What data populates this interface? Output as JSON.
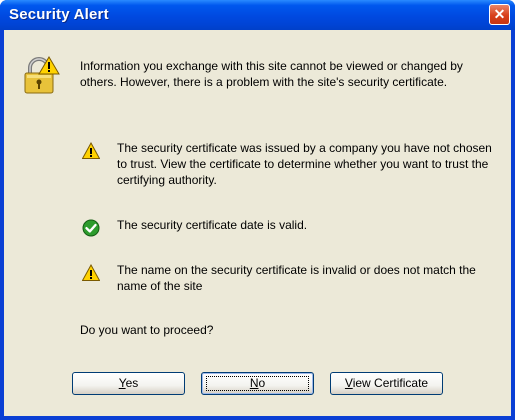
{
  "window": {
    "title": "Security Alert",
    "close_glyph": "✕"
  },
  "icons": {
    "main": "lock-warning-icon",
    "warning": "warning-icon",
    "valid": "check-icon"
  },
  "colors": {
    "titlebar": "#0054e3",
    "client": "#ece9d8",
    "close": "#d8401c",
    "warning": "#ffd200",
    "valid": "#2d9c2d"
  },
  "intro": "Information you exchange with this site cannot be viewed or changed by others. However, there is a problem with the site's security certificate.",
  "items": [
    {
      "icon": "warning-icon",
      "text": "The security certificate was issued by a company you have not chosen to trust. View the certificate to determine whether you want to trust the certifying authority."
    },
    {
      "icon": "check-icon",
      "text": "The security certificate date is valid."
    },
    {
      "icon": "warning-icon",
      "text": "The name on the security certificate is invalid or does not match the name of the site"
    }
  ],
  "prompt": "Do you want to proceed?",
  "buttons": {
    "yes": {
      "access_key": "Y",
      "rest": "es"
    },
    "no": {
      "access_key": "N",
      "rest": "o"
    },
    "view": {
      "access_key": "V",
      "rest": "iew Certificate"
    }
  }
}
